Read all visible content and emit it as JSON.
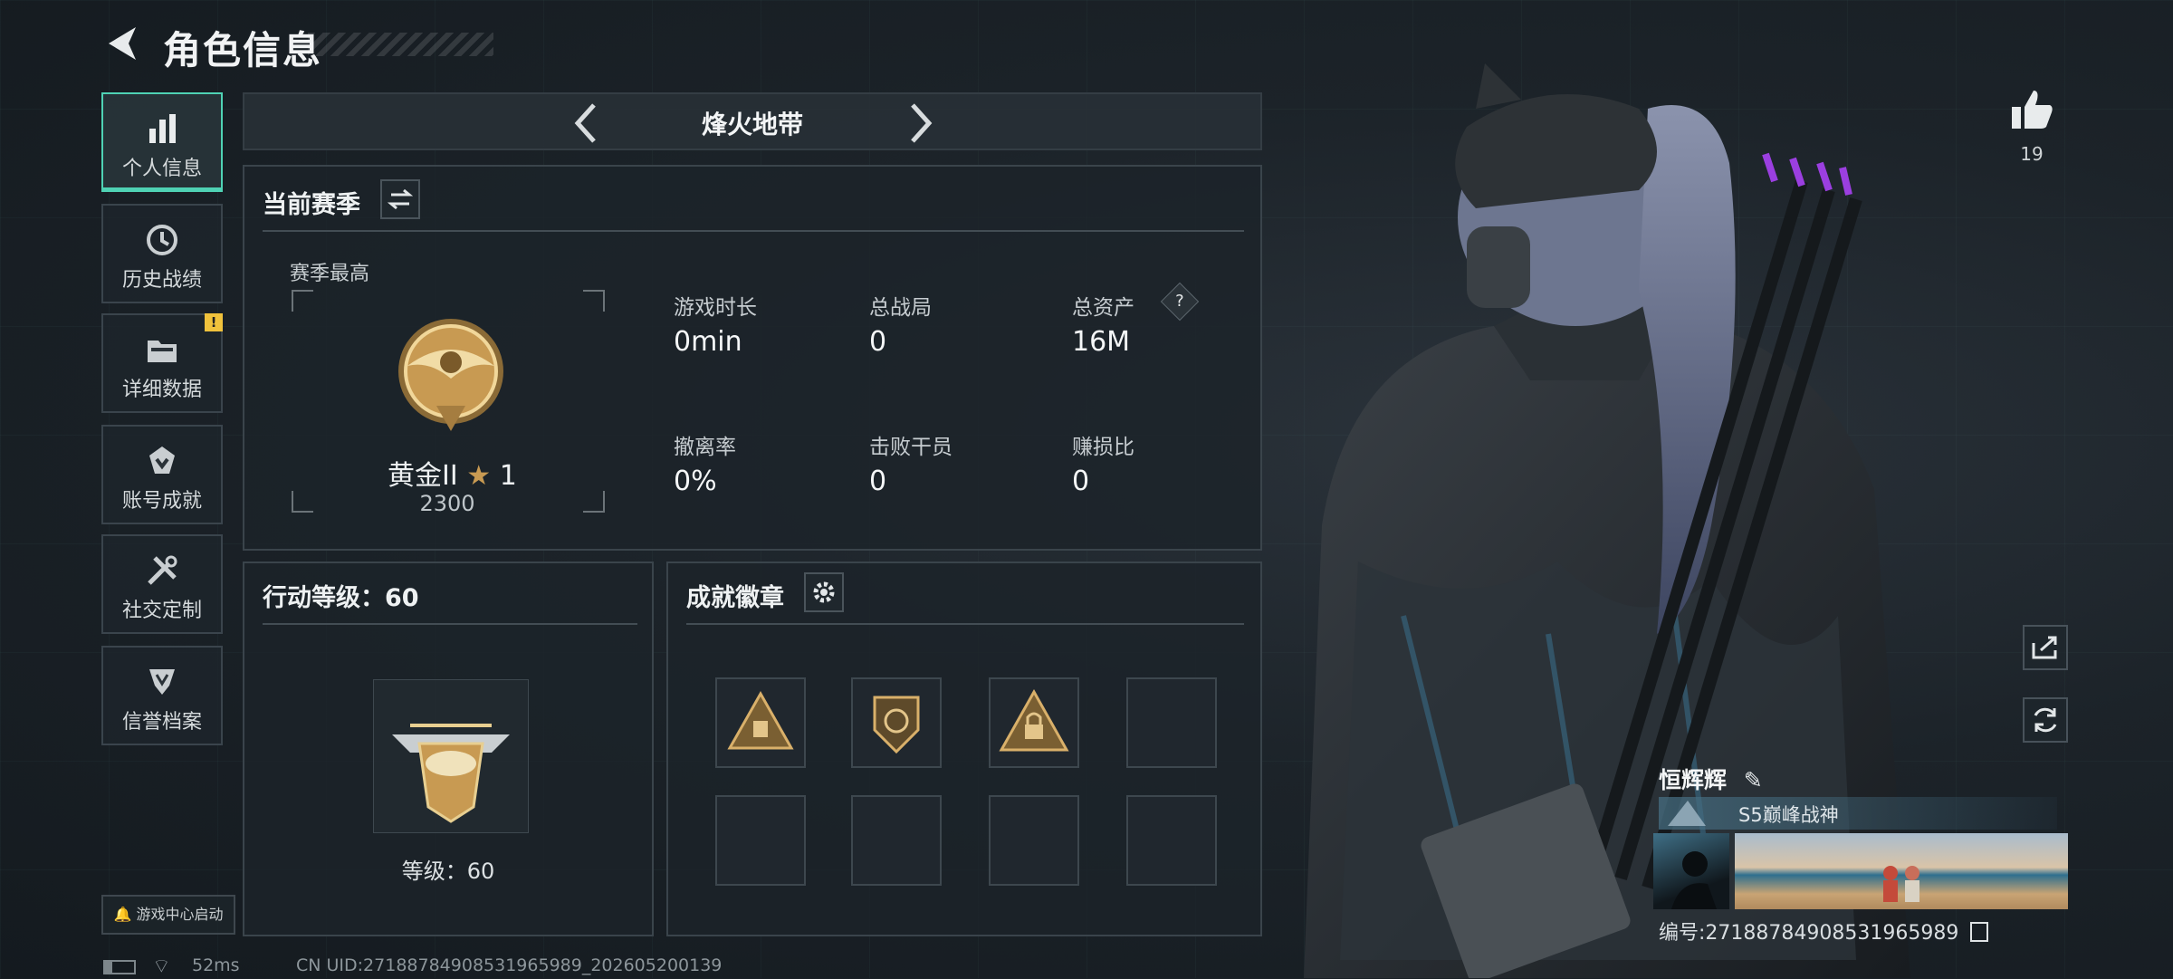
{
  "header": {
    "title": "角色信息"
  },
  "sidebar": {
    "items": [
      {
        "label": "个人信息",
        "icon": "bar-chart-icon",
        "active": true
      },
      {
        "label": "历史战绩",
        "icon": "history-clock-icon"
      },
      {
        "label": "详细数据",
        "icon": "folder-icon",
        "badge": "!"
      },
      {
        "label": "账号成就",
        "icon": "achievement-icon"
      },
      {
        "label": "社交定制",
        "icon": "tools-icon"
      },
      {
        "label": "信誉档案",
        "icon": "shield-emblem-icon"
      }
    ],
    "launch_label": "游戏中心启动"
  },
  "mode": {
    "name": "烽火地带"
  },
  "season": {
    "title": "当前赛季",
    "best_label": "赛季最高",
    "rank_name": "黄金II",
    "rank_stars": "1",
    "rank_score": "2300",
    "stats": [
      {
        "label": "游戏时长",
        "value": "0min"
      },
      {
        "label": "总战局",
        "value": "0"
      },
      {
        "label": "总资产",
        "value": "16M",
        "help": "?"
      },
      {
        "label": "撤离率",
        "value": "0%"
      },
      {
        "label": "击败干员",
        "value": "0"
      },
      {
        "label": "赚损比",
        "value": "0"
      }
    ]
  },
  "action_level": {
    "title": "行动等级：60",
    "level_text": "等级：60"
  },
  "achievements": {
    "title": "成就徽章"
  },
  "player": {
    "likes": "19",
    "name": "恒辉辉",
    "title": "S5巅峰战神",
    "id_text": "编号:2718878490853196598​9"
  },
  "footer": {
    "ping": "52ms",
    "uid": "CN UID:27188784908531965989_202605200139"
  },
  "colors": {
    "accent": "#4fd2b4",
    "badge": "#f0c23c",
    "gold": "#c89a52"
  }
}
